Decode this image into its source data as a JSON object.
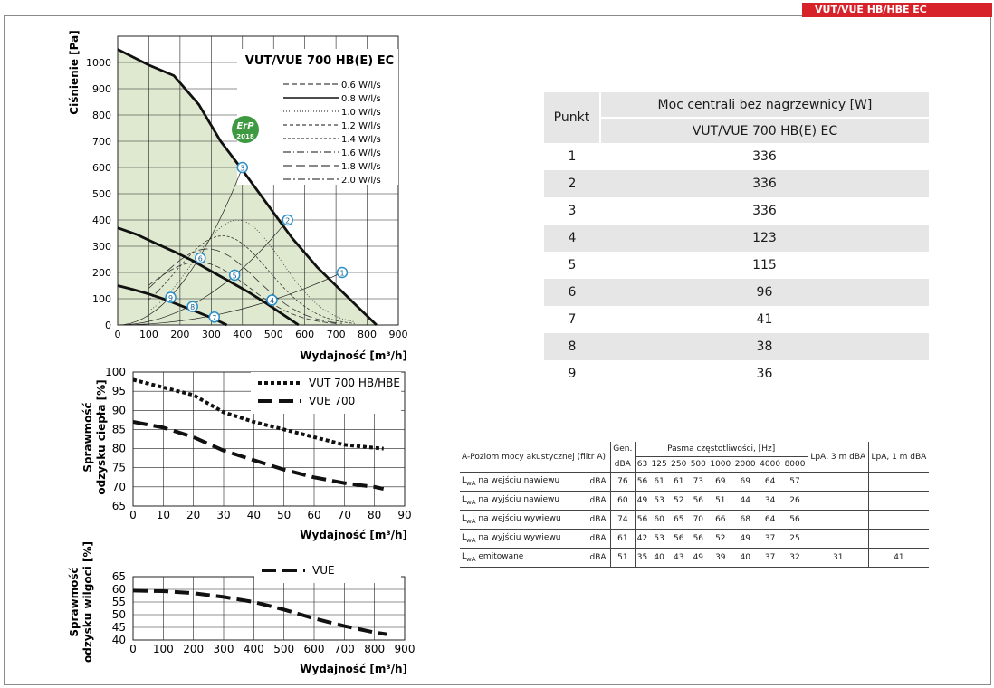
{
  "header": {
    "tag": "VUT/VUE HB/HBE EC"
  },
  "chart_data": [
    {
      "type": "line",
      "title": "VUT/VUE 700 HB(E) EC",
      "xlabel": "Wydajność [m³/h]",
      "ylabel": "Ciśnienie [Pa]",
      "xlim": [
        0,
        900
      ],
      "ylim": [
        0,
        1100
      ],
      "x_ticks": [
        "0",
        "100",
        "200",
        "300",
        "400",
        "500",
        "600",
        "700",
        "800",
        "900"
      ],
      "y_ticks": [
        "0",
        "100",
        "200",
        "300",
        "400",
        "500",
        "600",
        "700",
        "800",
        "900",
        "1000"
      ],
      "grid": true,
      "badge": {
        "line1": "ErP",
        "line2": "2018"
      },
      "legend_position": "top-right",
      "legend": [
        "0.6 W/l/s",
        "0.8 W/l/s",
        "1.0 W/l/s",
        "1.2 W/l/s",
        "1.4 W/l/s",
        "1.6 W/l/s",
        "1.8 W/l/s",
        "2.0 W/l/s"
      ],
      "fan_curves": [
        {
          "x": [
            0,
            100,
            180,
            260,
            330,
            400,
            480,
            560,
            640,
            700,
            760,
            830
          ],
          "y": [
            1050,
            990,
            950,
            840,
            700,
            590,
            460,
            330,
            220,
            150,
            80,
            0
          ]
        },
        {
          "x": [
            0,
            60,
            120,
            180,
            240,
            300,
            360,
            420,
            480,
            530,
            580
          ],
          "y": [
            370,
            345,
            312,
            280,
            245,
            205,
            165,
            125,
            80,
            40,
            0
          ]
        },
        {
          "x": [
            0,
            50,
            100,
            150,
            200,
            250,
            300,
            350
          ],
          "y": [
            150,
            135,
            118,
            98,
            75,
            52,
            28,
            0
          ]
        }
      ],
      "points": [
        {
          "label": "1",
          "x": 720,
          "y": 200
        },
        {
          "label": "2",
          "x": 545,
          "y": 400
        },
        {
          "label": "3",
          "x": 400,
          "y": 600
        },
        {
          "label": "4",
          "x": 495,
          "y": 95
        },
        {
          "label": "5",
          "x": 375,
          "y": 190
        },
        {
          "label": "6",
          "x": 265,
          "y": 255
        },
        {
          "label": "7",
          "x": 310,
          "y": 30
        },
        {
          "label": "8",
          "x": 240,
          "y": 70
        },
        {
          "label": "9",
          "x": 170,
          "y": 105
        }
      ]
    },
    {
      "type": "line",
      "title": "",
      "xlabel": "Wydajność [m³/h]",
      "ylabel": "Sprawmość odzysku ciepła [%]",
      "xlim": [
        0,
        90
      ],
      "ylim": [
        65,
        100
      ],
      "x_ticks": [
        "0",
        "10",
        "20",
        "30",
        "40",
        "50",
        "60",
        "70",
        "80",
        "90"
      ],
      "y_ticks": [
        "65",
        "70",
        "75",
        "80",
        "85",
        "90",
        "95",
        "100"
      ],
      "legend_position": "top-right",
      "series": [
        {
          "name": "VUT 700 HB/HBE",
          "x": [
            0,
            10,
            20,
            30,
            40,
            50,
            60,
            70,
            80,
            83
          ],
          "y": [
            98,
            96,
            94,
            89.5,
            87,
            85,
            83,
            81,
            80.2,
            80
          ]
        },
        {
          "name": "VUE 700",
          "x": [
            0,
            10,
            20,
            30,
            40,
            50,
            60,
            70,
            80,
            83
          ],
          "y": [
            87,
            85.5,
            83,
            79.5,
            77,
            74.5,
            72.5,
            71,
            70,
            69.5
          ]
        }
      ]
    },
    {
      "type": "line",
      "title": "",
      "xlabel": "Wydajność [m³/h]",
      "ylabel": "Sprawmość odzysku wilgoci [%]",
      "xlim": [
        0,
        900
      ],
      "ylim": [
        40,
        65
      ],
      "x_ticks": [
        "0",
        "100",
        "200",
        "300",
        "400",
        "500",
        "600",
        "700",
        "800",
        "900"
      ],
      "y_ticks": [
        "40",
        "45",
        "50",
        "55",
        "60",
        "65"
      ],
      "legend_position": "top-right",
      "series": [
        {
          "name": "VUE",
          "x": [
            0,
            100,
            200,
            300,
            400,
            500,
            600,
            700,
            800,
            840
          ],
          "y": [
            59.5,
            59.3,
            58.5,
            57,
            55,
            52,
            48.5,
            45.5,
            43,
            42.3
          ]
        }
      ]
    }
  ],
  "power_table": {
    "col_punkt": "Punkt",
    "header": "Moc centrali bez nagrzewnicy [W]",
    "subheader": "VUT/VUE 700 HB(E) EC",
    "rows": [
      {
        "p": "1",
        "v": "336"
      },
      {
        "p": "2",
        "v": "336"
      },
      {
        "p": "3",
        "v": "336"
      },
      {
        "p": "4",
        "v": "123"
      },
      {
        "p": "5",
        "v": "115"
      },
      {
        "p": "6",
        "v": "96"
      },
      {
        "p": "7",
        "v": "41"
      },
      {
        "p": "8",
        "v": "38"
      },
      {
        "p": "9",
        "v": "36"
      }
    ]
  },
  "acoustic_table": {
    "title": "A-Poziom mocy akustycznej (filtr A)",
    "gen": "Gen.",
    "band_header": "Pasma częstotliwości, [Hz]",
    "lpa3": "LpA, 3 m dBA",
    "lpa1": "LpA, 1 m dBA",
    "unit": "dBA",
    "freqs": [
      "63",
      "125",
      "250",
      "500",
      "1000",
      "2000",
      "4000",
      "8000"
    ],
    "rows": [
      {
        "prefix": "L",
        "sub": "wA",
        "label": " na wejściu nawiewu",
        "unit": "dBA",
        "gen": "76",
        "vals": [
          "56",
          "61",
          "61",
          "73",
          "69",
          "69",
          "64",
          "57"
        ],
        "lpa3": "",
        "lpa1": ""
      },
      {
        "prefix": "L",
        "sub": "wA",
        "label": " na wyjściu nawiewu",
        "unit": "dBA",
        "gen": "60",
        "vals": [
          "49",
          "53",
          "52",
          "56",
          "51",
          "44",
          "34",
          "26"
        ],
        "lpa3": "",
        "lpa1": ""
      },
      {
        "prefix": "L",
        "sub": "wA",
        "label": " na wejściu wywiewu",
        "unit": "dBA",
        "gen": "74",
        "vals": [
          "56",
          "60",
          "65",
          "70",
          "66",
          "68",
          "64",
          "56"
        ],
        "lpa3": "",
        "lpa1": ""
      },
      {
        "prefix": "L",
        "sub": "wA",
        "label": " na wyjściu wywiewu",
        "unit": "dBA",
        "gen": "61",
        "vals": [
          "42",
          "53",
          "56",
          "56",
          "52",
          "49",
          "37",
          "25"
        ],
        "lpa3": "",
        "lpa1": ""
      },
      {
        "prefix": "L",
        "sub": "wA",
        "label": " emitowane",
        "unit": "dBA",
        "gen": "51",
        "vals": [
          "35",
          "40",
          "43",
          "49",
          "39",
          "40",
          "37",
          "32"
        ],
        "lpa3": "31",
        "lpa1": "41"
      }
    ]
  }
}
